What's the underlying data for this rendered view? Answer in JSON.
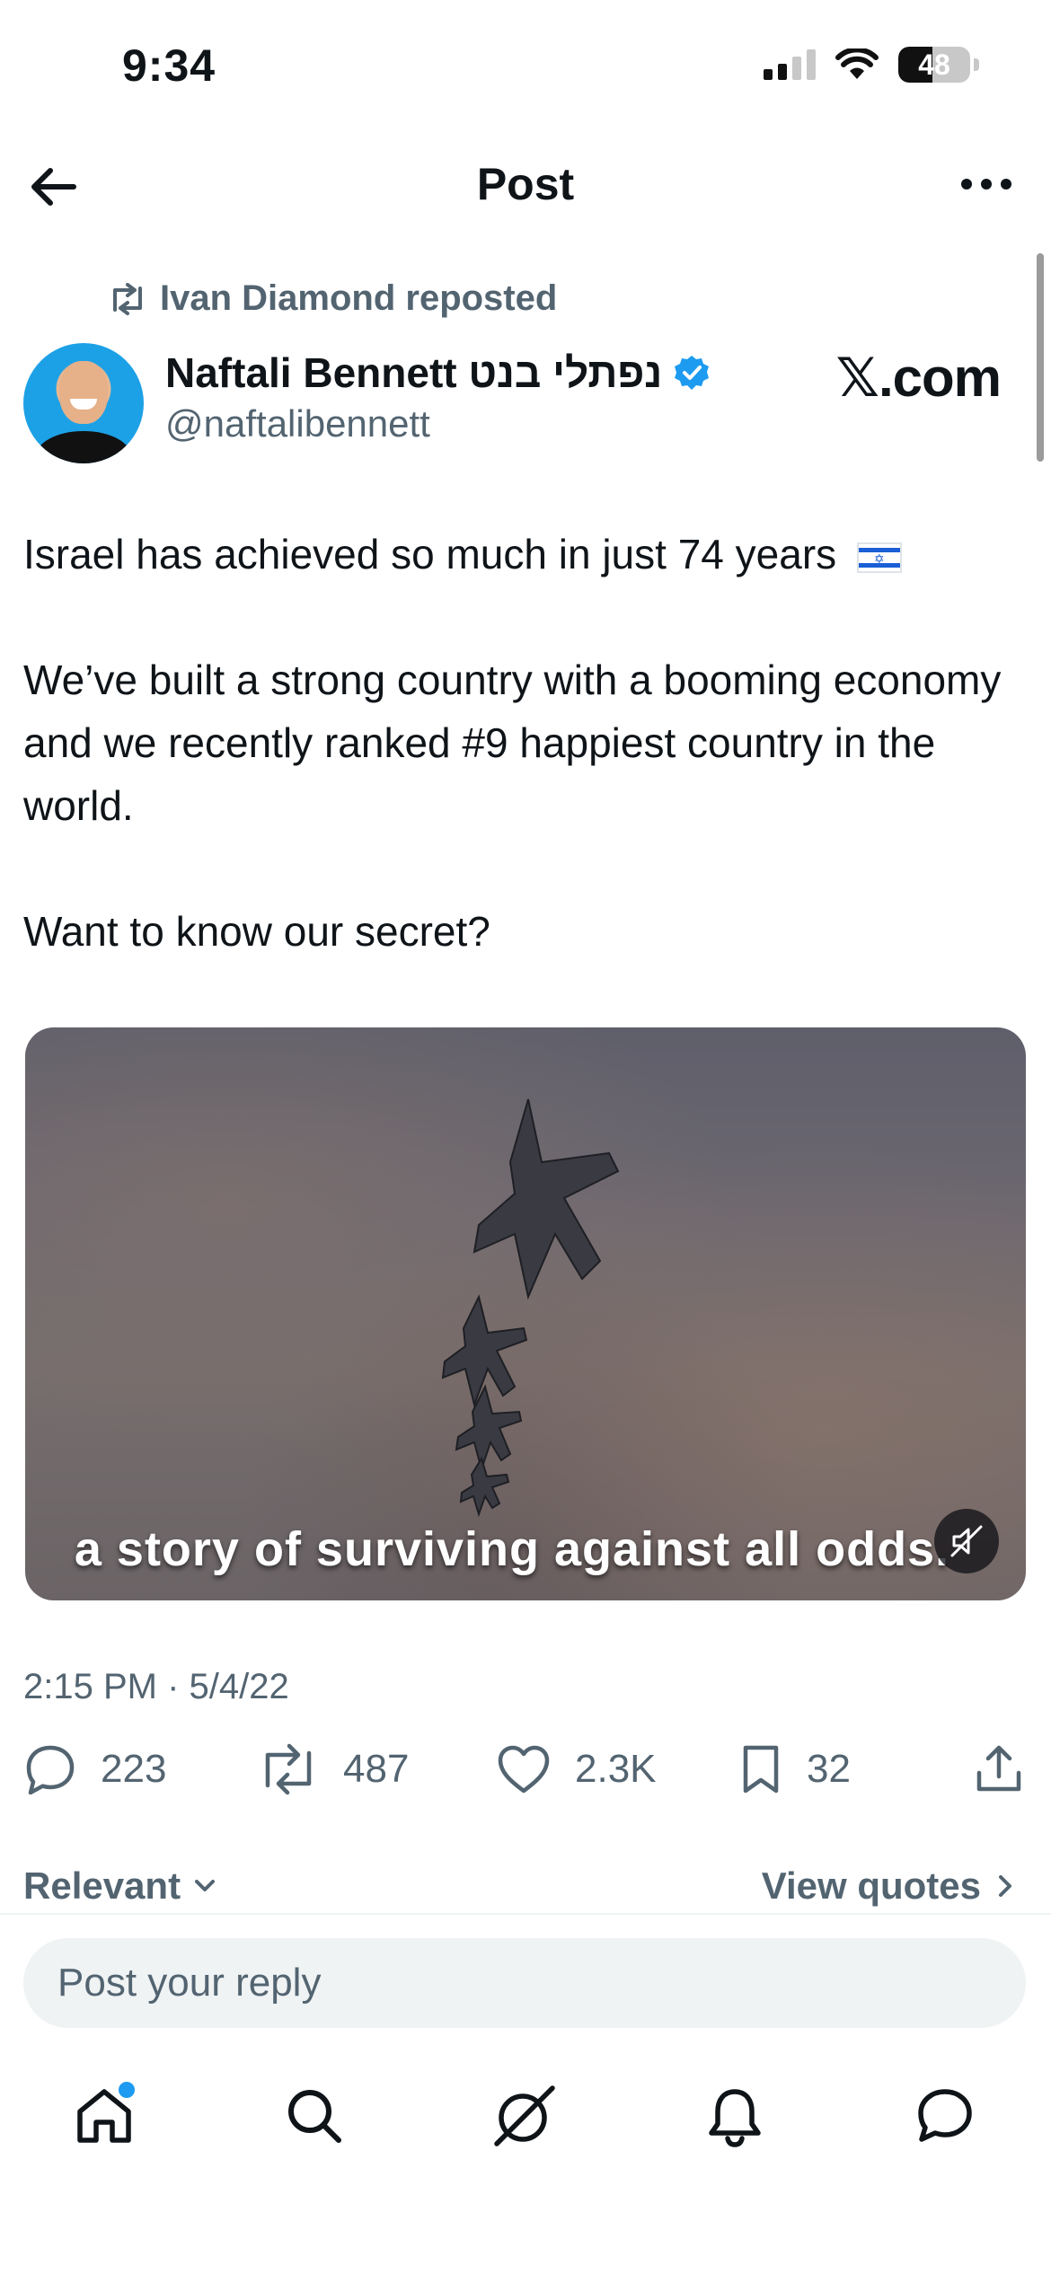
{
  "status_bar": {
    "time": "9:34",
    "battery_percent": "48",
    "battery_level": 0.48,
    "icons": [
      "cellular-signal-icon",
      "wifi-icon",
      "battery-icon"
    ]
  },
  "header": {
    "title": "Post",
    "back_icon": "arrow-left-icon",
    "more_icon": "more-horizontal-icon"
  },
  "post": {
    "repost_label": "Ivan Diamond reposted",
    "author_name": "Naftali Bennett נפתלי בנט",
    "verified": true,
    "handle": "@naftalibennett",
    "source_label": "𝕏.com",
    "paragraphs": [
      "Israel has achieved so much in just 74 years",
      "We’ve built a strong country with a booming economy and we recently ranked #9 happiest country in the world.",
      "Want to know our secret?"
    ],
    "flag_icon": "israel-flag-icon",
    "media": {
      "caption": "a story of surviving against all odds.",
      "mute_icon": "muted-speaker-icon"
    },
    "timestamp": "2:15 PM · 5/4/22",
    "stats": {
      "replies": "223",
      "reposts": "487",
      "likes": "2.3K",
      "bookmarks": "32"
    }
  },
  "replies_section": {
    "sort_label": "Relevant",
    "view_quotes_label": "View quotes"
  },
  "reply_box": {
    "placeholder": "Post your reply"
  },
  "bottom_nav": {
    "items": [
      "home-icon",
      "search-icon",
      "grok-icon",
      "notifications-icon",
      "messages-icon"
    ],
    "home_has_notification_dot": true
  },
  "colors": {
    "text_primary": "#0f1419",
    "text_secondary": "#536471",
    "accent_blue": "#1d9bf0",
    "input_bg": "#eff3f4"
  }
}
